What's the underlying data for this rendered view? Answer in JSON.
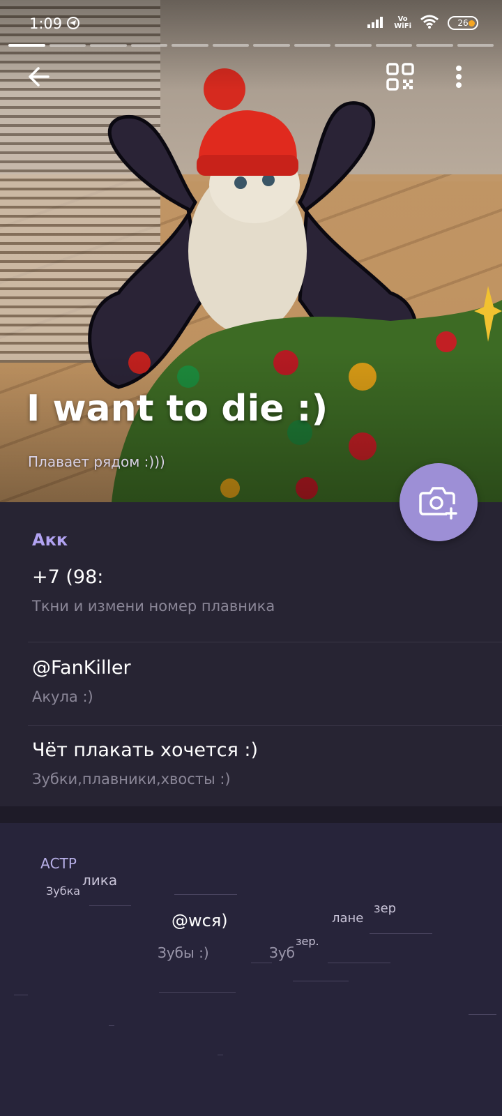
{
  "status_bar": {
    "time": "1:09",
    "network": "Vo\nWiFi",
    "battery": "26"
  },
  "story": {
    "segments": 12,
    "active": 0
  },
  "header": {
    "back_icon": "arrow-left-icon",
    "qr_icon": "qr-code-icon",
    "menu_icon": "more-vert-icon"
  },
  "profile": {
    "name": "I want to die :)",
    "status": "Плавает рядом :)))",
    "camera_icon": "camera-add-icon"
  },
  "account": {
    "title": "Акк",
    "phone": "+7 (98:",
    "phone_hint": "Ткни и измени номер плавника",
    "username": "@FanKiller",
    "username_hint": "Акула :)",
    "bio": "Чёт плакать хочется :)",
    "bio_hint": "Зубки,плавники,хвосты :)"
  },
  "glitch_fragments": {
    "f1": "АСТР",
    "f2": "лика",
    "f3": "Зубка",
    "f4": "@wcя)",
    "f5": "Зубы :)",
    "f6": "Зуб",
    "f7": "зер.",
    "f8": "лане",
    "f9": "зер"
  },
  "colors": {
    "accent": "#b2a3f2",
    "fab": "#9d8fd6",
    "background": "#272433"
  }
}
